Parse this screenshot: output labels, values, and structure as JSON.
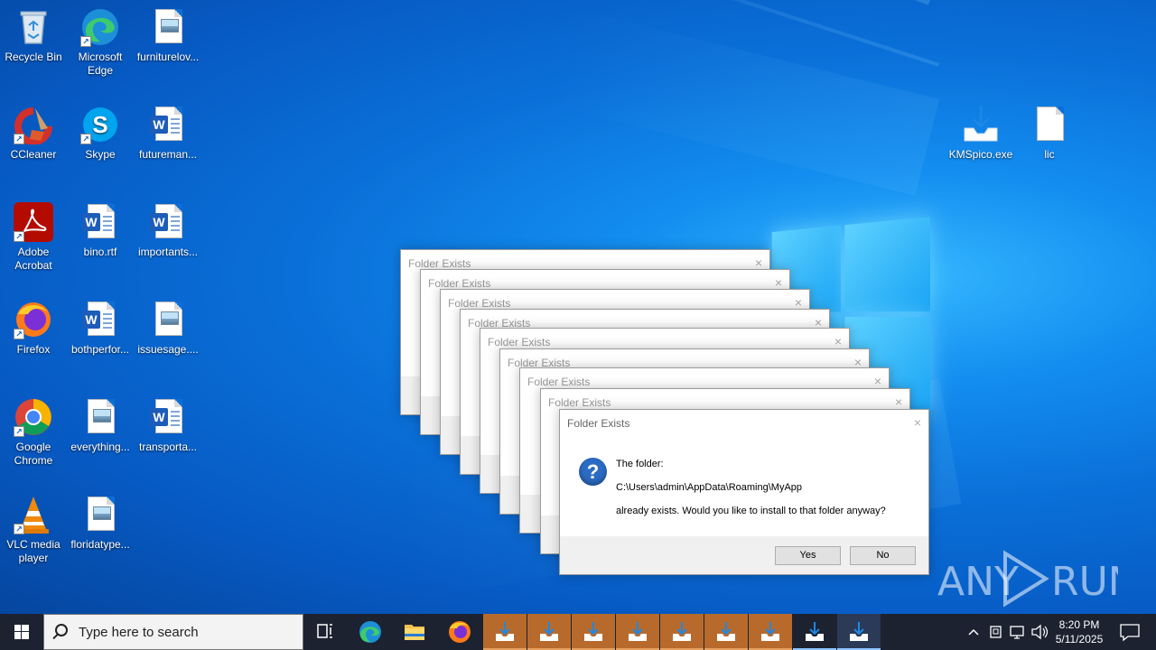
{
  "desktop_icons": [
    {
      "label": "Recycle Bin",
      "icon": "recycle-bin-icon"
    },
    {
      "label": "Microsoft Edge",
      "icon": "edge-icon"
    },
    {
      "label": "furniturelov...",
      "icon": "image-file-icon"
    },
    {
      "label": "CCleaner",
      "icon": "ccleaner-icon"
    },
    {
      "label": "Skype",
      "icon": "skype-icon"
    },
    {
      "label": "futureman...",
      "icon": "word-doc-icon"
    },
    {
      "label": "Adobe Acrobat",
      "icon": "acrobat-icon"
    },
    {
      "label": "bino.rtf",
      "icon": "word-doc-icon"
    },
    {
      "label": "importants...",
      "icon": "word-doc-icon"
    },
    {
      "label": "Firefox",
      "icon": "firefox-icon"
    },
    {
      "label": "bothperfor...",
      "icon": "word-doc-icon"
    },
    {
      "label": "issuesage....",
      "icon": "image-file-icon"
    },
    {
      "label": "Google Chrome",
      "icon": "chrome-icon"
    },
    {
      "label": "everything...",
      "icon": "image-file-icon"
    },
    {
      "label": "transporta...",
      "icon": "word-doc-icon"
    },
    {
      "label": "VLC media player",
      "icon": "vlc-icon"
    },
    {
      "label": "floridatype...",
      "icon": "image-file-icon"
    },
    {
      "label": "KMSpico.exe",
      "icon": "installer-icon"
    },
    {
      "label": "lic",
      "icon": "blank-file-icon"
    }
  ],
  "dialog": {
    "title": "Folder Exists",
    "close_glyph": "×",
    "line1": "The folder:",
    "line2": "C:\\Users\\admin\\AppData\\Roaming\\MyApp",
    "line3": "already exists. Would you like to install to that folder anyway?",
    "yes_label": "Yes",
    "no_label": "No",
    "icon_glyph": "?"
  },
  "watermark": {
    "text": "ANY  RUN"
  },
  "taskbar": {
    "search_placeholder": "Type here to search",
    "time": "8:20 PM",
    "date": "5/11/2025",
    "running_apps": 9
  }
}
